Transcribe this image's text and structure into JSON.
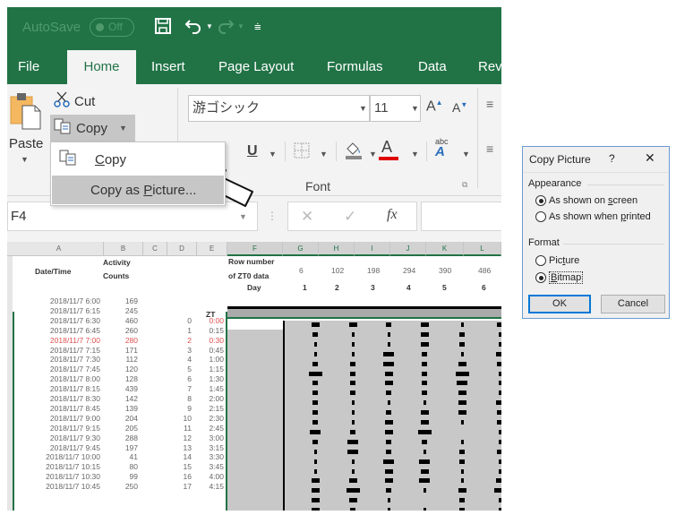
{
  "titlebar": {
    "autosave_label": "AutoSave",
    "autosave_state": "Off",
    "icons": [
      "save-icon",
      "undo-icon",
      "redo-icon",
      "customize-qat-icon"
    ]
  },
  "ribbon_tabs": [
    {
      "label": "File",
      "active": false
    },
    {
      "label": "Home",
      "active": true
    },
    {
      "label": "Insert",
      "active": false
    },
    {
      "label": "Page Layout",
      "active": false
    },
    {
      "label": "Formulas",
      "active": false
    },
    {
      "label": "Data",
      "active": false
    },
    {
      "label": "Rev",
      "active": false
    }
  ],
  "clipboard": {
    "paste_label": "Paste",
    "cut_label": "Cut",
    "copy_label": "Copy"
  },
  "font": {
    "name": "游ゴシック",
    "size": "11",
    "group_label": "Font",
    "font_color": "#e00000"
  },
  "copy_menu": {
    "items": [
      {
        "label_pre": "",
        "label_u": "C",
        "label_post": "opy",
        "icon": "copy-icon",
        "highlighted": false
      },
      {
        "label_pre": "Copy as ",
        "label_u": "P",
        "label_post": "icture...",
        "highlighted": true
      }
    ]
  },
  "formula_bar": {
    "name_box": "F4",
    "cancel_icon": "✕",
    "enter_icon": "✓",
    "fx_label": "fx",
    "formula": ""
  },
  "columns": [
    "A",
    "B",
    "C",
    "D",
    "E",
    "F",
    "G",
    "H",
    "I",
    "J",
    "K",
    "L"
  ],
  "sheet": {
    "header_datetime": "Date/Time",
    "header_activity_1": "Activity",
    "header_activity_2": "Counts",
    "header_zt": "ZT",
    "header_rownum_1": "Row number",
    "header_rownum_2": "of ZT0 data",
    "header_day": "Day",
    "rownums": [
      "6",
      "102",
      "198",
      "294",
      "390",
      "486"
    ],
    "days": [
      "1",
      "2",
      "3",
      "4",
      "5",
      "6"
    ],
    "rows": [
      {
        "dt": "2018/11/7 6:00",
        "count": "169",
        "idx": "",
        "zt": "",
        "red": false
      },
      {
        "dt": "2018/11/7 6:15",
        "count": "245",
        "idx": "",
        "zt": "",
        "red": false
      },
      {
        "dt": "2018/11/7 6:30",
        "count": "460",
        "idx": "0",
        "zt": "0:00",
        "red": false,
        "zt_red": true
      },
      {
        "dt": "2018/11/7 6:45",
        "count": "260",
        "idx": "1",
        "zt": "0:15",
        "red": false
      },
      {
        "dt": "2018/11/7 7:00",
        "count": "280",
        "idx": "2",
        "zt": "0:30",
        "red": true
      },
      {
        "dt": "2018/11/7 7:15",
        "count": "171",
        "idx": "3",
        "zt": "0:45",
        "red": false
      },
      {
        "dt": "2018/11/7 7:30",
        "count": "112",
        "idx": "4",
        "zt": "1:00",
        "red": false
      },
      {
        "dt": "2018/11/7 7:45",
        "count": "120",
        "idx": "5",
        "zt": "1:15",
        "red": false
      },
      {
        "dt": "2018/11/7 8:00",
        "count": "128",
        "idx": "6",
        "zt": "1:30",
        "red": false
      },
      {
        "dt": "2018/11/7 8:15",
        "count": "439",
        "idx": "7",
        "zt": "1:45",
        "red": false
      },
      {
        "dt": "2018/11/7 8:30",
        "count": "142",
        "idx": "8",
        "zt": "2:00",
        "red": false
      },
      {
        "dt": "2018/11/7 8:45",
        "count": "139",
        "idx": "9",
        "zt": "2:15",
        "red": false
      },
      {
        "dt": "2018/11/7 9:00",
        "count": "204",
        "idx": "10",
        "zt": "2:30",
        "red": false
      },
      {
        "dt": "2018/11/7 9:15",
        "count": "205",
        "idx": "11",
        "zt": "2:45",
        "red": false
      },
      {
        "dt": "2018/11/7 9:30",
        "count": "288",
        "idx": "12",
        "zt": "3:00",
        "red": false
      },
      {
        "dt": "2018/11/7 9:45",
        "count": "197",
        "idx": "13",
        "zt": "3:15",
        "red": false
      },
      {
        "dt": "2018/11/7 10:00",
        "count": "41",
        "idx": "14",
        "zt": "3:30",
        "red": false
      },
      {
        "dt": "2018/11/7 10:15",
        "count": "80",
        "idx": "15",
        "zt": "3:45",
        "red": false
      },
      {
        "dt": "2018/11/7 10:30",
        "count": "99",
        "idx": "16",
        "zt": "4:00",
        "red": false
      },
      {
        "dt": "2018/11/7 10:45",
        "count": "250",
        "idx": "17",
        "zt": "4:15",
        "red": false
      }
    ],
    "actogram_widths": [
      [
        3,
        3,
        2,
        3,
        1,
        2
      ],
      [
        2,
        1,
        1,
        3,
        2,
        1
      ],
      [
        1,
        1,
        1,
        3,
        2,
        1
      ],
      [
        1,
        1,
        4,
        2,
        1,
        3
      ],
      [
        2,
        2,
        4,
        2,
        3,
        2
      ],
      [
        5,
        2,
        3,
        2,
        5,
        1
      ],
      [
        2,
        2,
        3,
        2,
        4,
        1
      ],
      [
        2,
        2,
        2,
        2,
        3,
        1
      ],
      [
        2,
        1,
        1,
        1,
        3,
        3
      ],
      [
        2,
        1,
        2,
        3,
        3,
        2
      ],
      [
        2,
        1,
        3,
        3,
        1,
        2
      ],
      [
        4,
        2,
        3,
        5,
        0,
        1
      ],
      [
        2,
        4,
        2,
        2,
        1,
        1
      ],
      [
        1,
        4,
        2,
        1,
        2,
        2
      ],
      [
        1,
        1,
        4,
        4,
        2,
        1
      ],
      [
        1,
        1,
        3,
        3,
        1,
        1
      ],
      [
        3,
        3,
        3,
        4,
        1,
        3
      ],
      [
        3,
        5,
        2,
        1,
        3,
        4
      ],
      [
        3,
        3,
        1,
        0,
        2,
        1
      ],
      [
        3,
        2,
        1,
        1,
        2,
        1
      ]
    ]
  },
  "dialog": {
    "title": "Copy Picture",
    "help": "?",
    "close": "✕",
    "appearance_label": "Appearance",
    "appearance_options": [
      {
        "pre": "As shown on ",
        "u": "s",
        "post": "creen",
        "selected": true
      },
      {
        "pre": "As shown when ",
        "u": "p",
        "post": "rinted",
        "selected": false
      }
    ],
    "format_label": "Format",
    "format_options": [
      {
        "pre": "Pic",
        "u": "t",
        "post": "ure",
        "selected": false
      },
      {
        "pre": "",
        "u": "B",
        "post": "itmap",
        "selected": true
      }
    ],
    "ok_label": "OK",
    "cancel_label": "Cancel"
  },
  "colors": {
    "excel_green": "#217346",
    "red_text": "#e05050",
    "dialog_focus_blue": "#0078d7"
  }
}
